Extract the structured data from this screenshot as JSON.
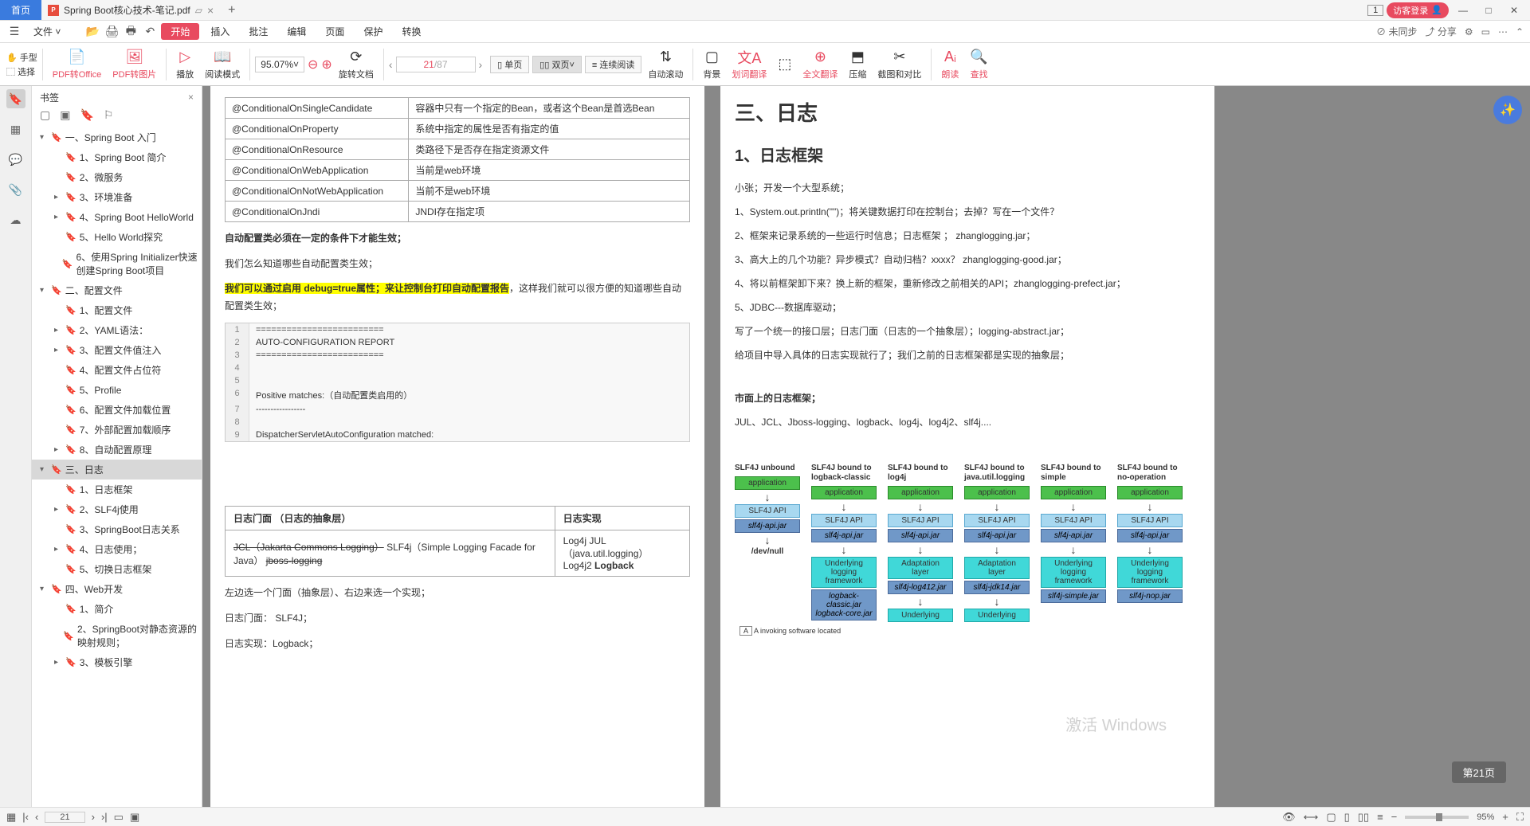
{
  "titlebar": {
    "home": "首页",
    "doc_title": "Spring Boot核心技术-笔记.pdf",
    "page_indicator": "1",
    "login": "访客登录"
  },
  "menubar": {
    "file": "文件",
    "start": "开始",
    "insert": "插入",
    "annotate": "批注",
    "edit": "编辑",
    "page": "页面",
    "protect": "保护",
    "convert": "转换",
    "not_sync": "未同步",
    "share": "分享"
  },
  "toolbar": {
    "hand": "手型",
    "select": "选择",
    "pdf_office": "PDF转Office",
    "pdf_img": "PDF转图片",
    "play": "播放",
    "read_mode": "阅读模式",
    "zoom": "95.07%",
    "rotate": "旋转文档",
    "page_current": "21",
    "page_total": "/87",
    "single": "单页",
    "double": "双页",
    "continuous": "连续阅读",
    "auto_scroll": "自动滚动",
    "background": "背景",
    "word_translate": "划词翻译",
    "full_translate": "全文翻译",
    "compress": "压缩",
    "screenshot": "截图和对比",
    "read_aloud": "朗读",
    "find": "查找"
  },
  "bookmarks": {
    "title": "书签",
    "tree": [
      {
        "level": 1,
        "expand": "▾",
        "text": "一、Spring Boot 入门"
      },
      {
        "level": 2,
        "expand": "",
        "text": "1、Spring Boot 简介"
      },
      {
        "level": 2,
        "expand": "",
        "text": "2、微服务"
      },
      {
        "level": 2,
        "expand": "▸",
        "text": "3、环境准备"
      },
      {
        "level": 2,
        "expand": "▸",
        "text": "4、Spring Boot HelloWorld"
      },
      {
        "level": 2,
        "expand": "",
        "text": "5、Hello World探究"
      },
      {
        "level": 2,
        "expand": "",
        "text": "6、使用Spring Initializer快速创建Spring Boot项目"
      },
      {
        "level": 1,
        "expand": "▾",
        "text": "二、配置文件"
      },
      {
        "level": 2,
        "expand": "",
        "text": "1、配置文件"
      },
      {
        "level": 2,
        "expand": "▸",
        "text": "2、YAML语法："
      },
      {
        "level": 2,
        "expand": "▸",
        "text": "3、配置文件值注入"
      },
      {
        "level": 2,
        "expand": "",
        "text": "4、配置文件占位符"
      },
      {
        "level": 2,
        "expand": "",
        "text": "5、Profile"
      },
      {
        "level": 2,
        "expand": "",
        "text": "6、配置文件加载位置"
      },
      {
        "level": 2,
        "expand": "",
        "text": "7、外部配置加载顺序"
      },
      {
        "level": 2,
        "expand": "▸",
        "text": "8、自动配置原理"
      },
      {
        "level": 1,
        "expand": "▾",
        "text": "三、日志",
        "active": true
      },
      {
        "level": 2,
        "expand": "",
        "text": "1、日志框架"
      },
      {
        "level": 2,
        "expand": "▸",
        "text": "2、SLF4j使用"
      },
      {
        "level": 2,
        "expand": "",
        "text": "3、SpringBoot日志关系"
      },
      {
        "level": 2,
        "expand": "▸",
        "text": "4、日志使用；"
      },
      {
        "level": 2,
        "expand": "",
        "text": "5、切换日志框架"
      },
      {
        "level": 1,
        "expand": "▾",
        "text": "四、Web开发"
      },
      {
        "level": 2,
        "expand": "",
        "text": "1、简介"
      },
      {
        "level": 2,
        "expand": "",
        "text": "2、SpringBoot对静态资源的映射规则；"
      },
      {
        "level": 2,
        "expand": "▸",
        "text": "3、模板引擎"
      }
    ]
  },
  "page_left": {
    "cond_table": [
      [
        "@ConditionalOnSingleCandidate",
        "容器中只有一个指定的Bean，或者这个Bean是首选Bean"
      ],
      [
        "@ConditionalOnProperty",
        "系统中指定的属性是否有指定的值"
      ],
      [
        "@ConditionalOnResource",
        "类路径下是否存在指定资源文件"
      ],
      [
        "@ConditionalOnWebApplication",
        "当前是web环境"
      ],
      [
        "@ConditionalOnNotWebApplication",
        "当前不是web环境"
      ],
      [
        "@ConditionalOnJndi",
        "JNDI存在指定项"
      ]
    ],
    "text1": "自动配置类必须在一定的条件下才能生效；",
    "text2": "我们怎么知道哪些自动配置类生效；",
    "hl": "我们可以通过启用 debug=true属性；来让控制台打印自动配置报告",
    "text3": "，这样我们就可以很方便的知道哪些自动配置类生效；",
    "code": [
      "=========================",
      "AUTO-CONFIGURATION REPORT",
      "=========================",
      "",
      "",
      "Positive matches:（自动配置类启用的）",
      "-----------------",
      "",
      "   DispatcherServletAutoConfiguration matched:"
    ],
    "log_table_h1": "日志门面 （日志的抽象层）",
    "log_table_h2": "日志实现",
    "facade_strike": "JCL（Jakarta Commons Logging）",
    "facade_rest": "   SLF4j（Simple Logging Facade for Java）   ",
    "facade_strike2": "jboss-logging",
    "impl": "Log4j  JUL（java.util.logging）  Log4j2  Logback",
    "text4": "左边选一个门面（抽象层）、右边来选一个实现；",
    "text5": "日志门面： SLF4J；",
    "text6": "日志实现：Logback；"
  },
  "page_right": {
    "h1": "三、日志",
    "h2": "1、日志框架",
    "p1": "小张；开发一个大型系统；",
    "p2": "1、System.out.println(\"\")；将关键数据打印在控制台；去掉？写在一个文件？",
    "p3": "2、框架来记录系统的一些运行时信息；日志框架 ； zhanglogging.jar；",
    "p4": "3、高大上的几个功能？异步模式？自动归档？xxxx？ zhanglogging-good.jar；",
    "p5": "4、将以前框架卸下来？换上新的框架，重新修改之前相关的API；zhanglogging-prefect.jar；",
    "p6": "5、JDBC---数据库驱动；",
    "p7": "写了一个统一的接口层；日志门面（日志的一个抽象层）；logging-abstract.jar；",
    "p8": "给项目中导入具体的日志实现就行了；我们之前的日志框架都是实现的抽象层；",
    "p9": "市面上的日志框架；",
    "p10": "JUL、JCL、Jboss-logging、logback、log4j、log4j2、slf4j....",
    "diagram": {
      "cols": [
        {
          "label": "SLF4J unbound",
          "app": "application",
          "api": "SLF4J API",
          "jar": "slf4j-api.jar",
          "bottom": "/dev/null"
        },
        {
          "label": "SLF4J bound to logback-classic",
          "app": "application",
          "api": "SLF4J API",
          "jar": "slf4j-api.jar",
          "mid": "Underlying logging framework",
          "midjar": "logback-classic.jar logback-core.jar"
        },
        {
          "label": "SLF4J bound to log4j",
          "app": "application",
          "api": "SLF4J API",
          "jar": "slf4j-api.jar",
          "mid": "Adaptation layer",
          "midjar": "slf4j-log412.jar",
          "bottom": "Underlying"
        },
        {
          "label": "SLF4J bound to java.util.logging",
          "app": "application",
          "api": "SLF4J API",
          "jar": "slf4j-api.jar",
          "mid": "Adaptation layer",
          "midjar": "slf4j-jdk14.jar",
          "bottom": "Underlying"
        },
        {
          "label": "SLF4J bound to simple",
          "app": "application",
          "api": "SLF4J API",
          "jar": "slf4j-api.jar",
          "bottom": "Underlying logging framework",
          "botjar": "slf4j-simple.jar"
        },
        {
          "label": "SLF4J bound to no-operation",
          "app": "application",
          "api": "SLF4J API",
          "jar": "slf4j-api.jar",
          "bottom": "Underlying logging framework",
          "botjar": "slf4j-nop.jar"
        }
      ],
      "note": "A invoking software located"
    }
  },
  "statusbar": {
    "page": "21",
    "zoom": "95%"
  },
  "page_badge": "第21页",
  "watermark": "激活 Windows"
}
